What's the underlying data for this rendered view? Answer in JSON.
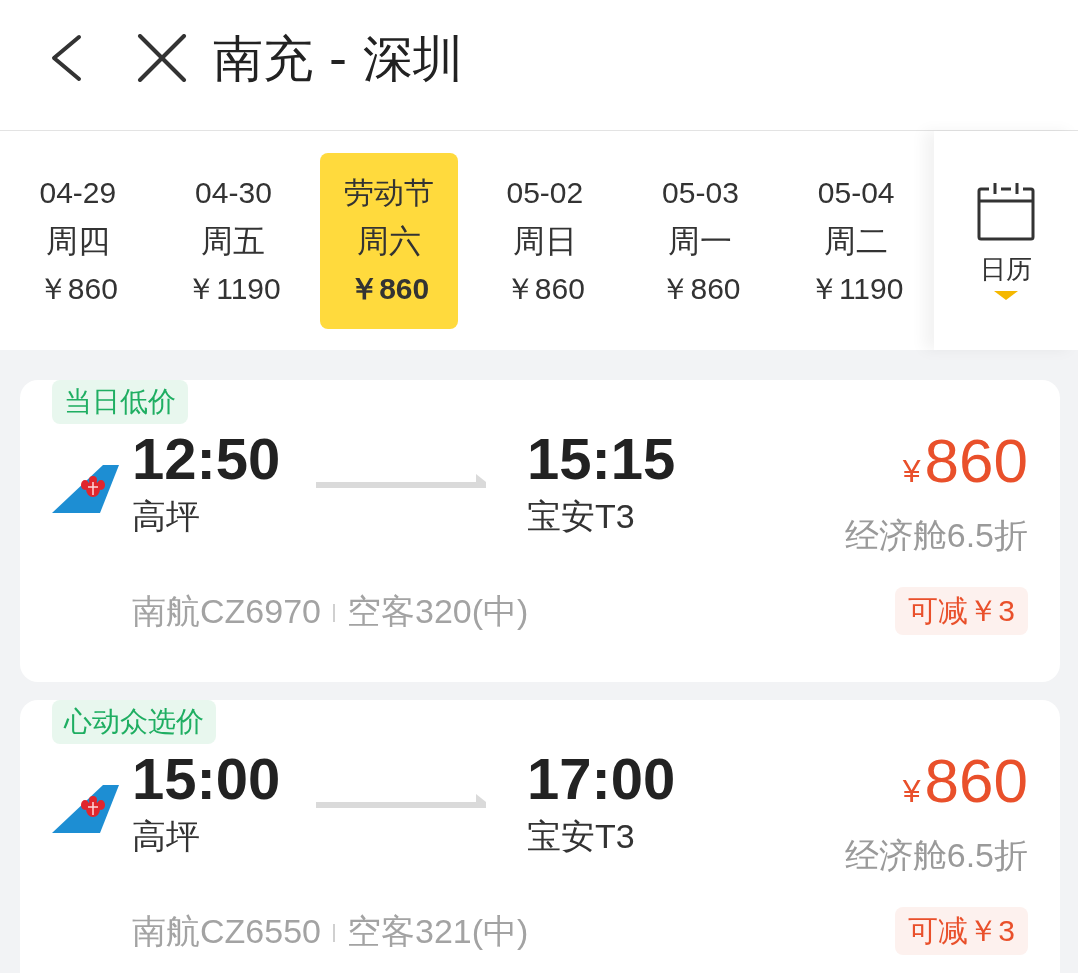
{
  "header": {
    "title": "南充 - 深圳"
  },
  "dates": [
    {
      "label": "04-29",
      "weekday": "周四",
      "price": "￥860",
      "selected": false
    },
    {
      "label": "04-30",
      "weekday": "周五",
      "price": "￥1190",
      "selected": false
    },
    {
      "label": "劳动节",
      "weekday": "周六",
      "price": "￥860",
      "selected": true
    },
    {
      "label": "05-02",
      "weekday": "周日",
      "price": "￥860",
      "selected": false
    },
    {
      "label": "05-03",
      "weekday": "周一",
      "price": "￥860",
      "selected": false
    },
    {
      "label": "05-04",
      "weekday": "周二",
      "price": "￥1190",
      "selected": false
    }
  ],
  "calendar": {
    "label": "日历"
  },
  "flights": [
    {
      "tag": "当日低价",
      "depart_time": "12:50",
      "depart_airport": "高坪",
      "arrive_time": "15:15",
      "arrive_airport": "宝安T3",
      "currency": "¥",
      "amount": "860",
      "cabin": "经济舱6.5折",
      "flight_no": "南航CZ6970",
      "aircraft": "空客320(中)",
      "discount": "可减￥3"
    },
    {
      "tag": "心动众选价",
      "depart_time": "15:00",
      "depart_airport": "高坪",
      "arrive_time": "17:00",
      "arrive_airport": "宝安T3",
      "currency": "¥",
      "amount": "860",
      "cabin": "经济舱6.5折",
      "flight_no": "南航CZ6550",
      "aircraft": "空客321(中)",
      "discount": "可减￥3"
    }
  ]
}
